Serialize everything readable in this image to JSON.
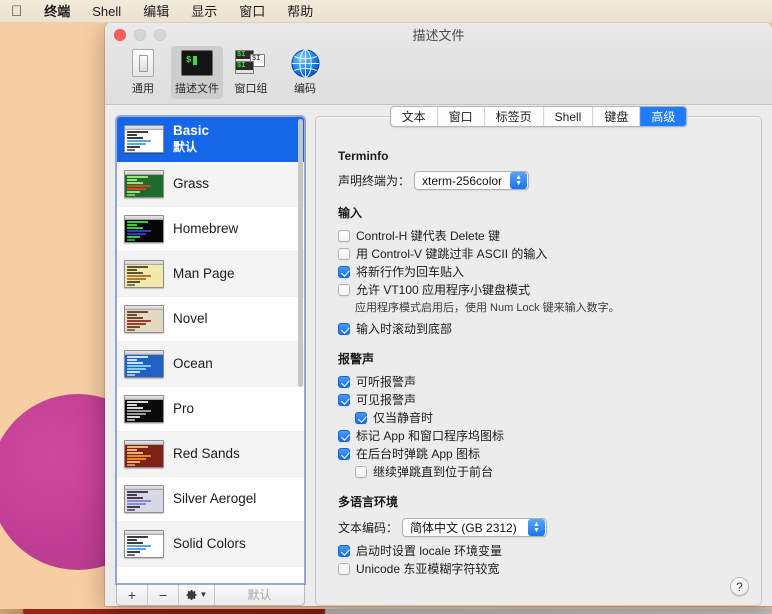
{
  "menubar": {
    "apple_icon": "apple-icon",
    "items": [
      "终端",
      "Shell",
      "编辑",
      "显示",
      "窗口",
      "帮助"
    ]
  },
  "window": {
    "title": "描述文件",
    "traffic_lights": [
      "close-button",
      "minimize-button",
      "zoom-button"
    ],
    "toolbar": [
      {
        "label": "通用",
        "icon": "generic-terminal-icon",
        "selected": false
      },
      {
        "label": "描述文件",
        "icon": "profile-terminal-icon",
        "selected": true
      },
      {
        "label": "窗口组",
        "icon": "window-group-icon",
        "selected": false
      },
      {
        "label": "编码",
        "icon": "globe-encoding-icon",
        "selected": false
      }
    ]
  },
  "sidebar": {
    "profiles": [
      {
        "name": "Basic",
        "subtitle": "默认",
        "selected": true,
        "thumb": {
          "bg": "#ffffff",
          "fg": "#3c3c3c",
          "accent": "#5aa6e8"
        }
      },
      {
        "name": "Grass",
        "subtitle": "",
        "selected": false,
        "thumb": {
          "bg": "#1f6b2e",
          "fg": "#9ee07a",
          "accent": "#d4481f"
        }
      },
      {
        "name": "Homebrew",
        "subtitle": "",
        "selected": false,
        "thumb": {
          "bg": "#050505",
          "fg": "#32d132",
          "accent": "#3a35c9"
        }
      },
      {
        "name": "Man Page",
        "subtitle": "",
        "selected": false,
        "thumb": {
          "bg": "#f4e9a8",
          "fg": "#5a5230",
          "accent": "#b07a32"
        }
      },
      {
        "name": "Novel",
        "subtitle": "",
        "selected": false,
        "thumb": {
          "bg": "#e3d9c2",
          "fg": "#6d4a2f",
          "accent": "#a33b2a"
        }
      },
      {
        "name": "Ocean",
        "subtitle": "",
        "selected": false,
        "thumb": {
          "bg": "#1f61c4",
          "fg": "#cfe4ff",
          "accent": "#7fd0ff"
        }
      },
      {
        "name": "Pro",
        "subtitle": "",
        "selected": false,
        "thumb": {
          "bg": "#0a0a0a",
          "fg": "#d8d8d8",
          "accent": "#9a9a9a"
        }
      },
      {
        "name": "Red Sands",
        "subtitle": "",
        "selected": false,
        "thumb": {
          "bg": "#7e2217",
          "fg": "#e8b27a",
          "accent": "#e8892a"
        }
      },
      {
        "name": "Silver Aerogel",
        "subtitle": "",
        "selected": false,
        "thumb": {
          "bg": "#d9d9e6",
          "fg": "#3e3e52",
          "accent": "#8a8ad0"
        }
      },
      {
        "name": "Solid Colors",
        "subtitle": "",
        "selected": false,
        "thumb": {
          "bg": "#ffffff",
          "fg": "#3c3c3c",
          "accent": "#5aa6e8"
        }
      }
    ],
    "tools": {
      "add_label": "+",
      "remove_label": "−",
      "gear_icon": "gear-icon",
      "gear_chevron": "chevron-down-icon",
      "default_label": "默认",
      "default_enabled": false
    }
  },
  "tabs": [
    {
      "label": "文本",
      "selected": false
    },
    {
      "label": "窗口",
      "selected": false
    },
    {
      "label": "标签页",
      "selected": false
    },
    {
      "label": "Shell",
      "selected": false
    },
    {
      "label": "键盘",
      "selected": false
    },
    {
      "label": "高级",
      "selected": true
    }
  ],
  "advanced": {
    "terminfo": {
      "title": "Terminfo",
      "declare_label": "声明终端为：",
      "terminal_type": "xterm-256color"
    },
    "input": {
      "title": "输入",
      "options": [
        {
          "label": "Control-H 键代表 Delete 键",
          "checked": false,
          "indent": false
        },
        {
          "label": "用 Control-V 键跳过非 ASCII 的输入",
          "checked": false,
          "indent": false
        },
        {
          "label": "将新行作为回车贴入",
          "checked": true,
          "indent": false
        },
        {
          "label": "允许 VT100 应用程序小键盘模式",
          "checked": false,
          "indent": false
        }
      ],
      "hint": "应用程序模式启用后，使用 Num Lock 键来输入数字。",
      "scroll_option": {
        "label": "输入时滚动到底部",
        "checked": true
      }
    },
    "bell": {
      "title": "报警声",
      "options": [
        {
          "label": "可听报警声",
          "checked": true,
          "indent": false
        },
        {
          "label": "可见报警声",
          "checked": true,
          "indent": false
        },
        {
          "label": "仅当静音时",
          "checked": true,
          "indent": true
        },
        {
          "label": "标记 App 和窗口程序坞图标",
          "checked": true,
          "indent": false
        },
        {
          "label": "在后台时弹跳 App 图标",
          "checked": true,
          "indent": false
        },
        {
          "label": "继续弹跳直到位于前台",
          "checked": false,
          "indent": true
        }
      ]
    },
    "international": {
      "title": "多语言环境",
      "encoding_label": "文本编码：",
      "encoding_value": "简体中文 (GB 2312)",
      "options": [
        {
          "label": "启动时设置 locale 环境变量",
          "checked": true
        },
        {
          "label": "Unicode 东亚模糊字符较宽",
          "checked": false
        }
      ]
    },
    "help_label": "?"
  },
  "colors": {
    "accent": "#1666e8",
    "tab_selected": "#1d7dfc",
    "desktop": "#f8cfa4",
    "blob": "#c03e93"
  }
}
